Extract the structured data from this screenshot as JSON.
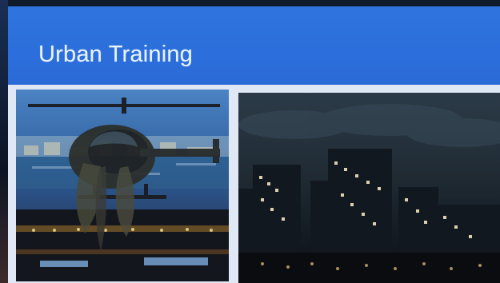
{
  "slide": {
    "title": "Urban Training"
  },
  "images": {
    "left": {
      "icon": "helicopter-over-city-photo"
    },
    "right": {
      "icon": "city-skyline-night-photo"
    }
  },
  "colors": {
    "title_bar": "#2c6fdc",
    "slide_bg": "#e8eef6",
    "frame_bg": "#0f1a2b"
  }
}
